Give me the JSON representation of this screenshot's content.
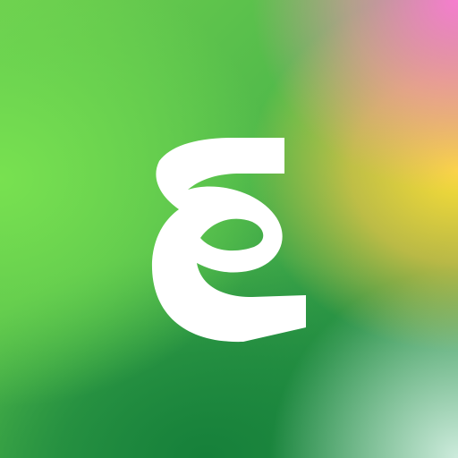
{
  "app_icon": {
    "glyph_icon": "stylized-epsilon-loop-icon",
    "colors": {
      "glyph": "#ffffff",
      "top_right": "#ff85d4",
      "right": "#f7d93a",
      "left": "#74de4f",
      "bottom": "#1a8a3c",
      "bottom_right": "#c9e8d8"
    }
  }
}
